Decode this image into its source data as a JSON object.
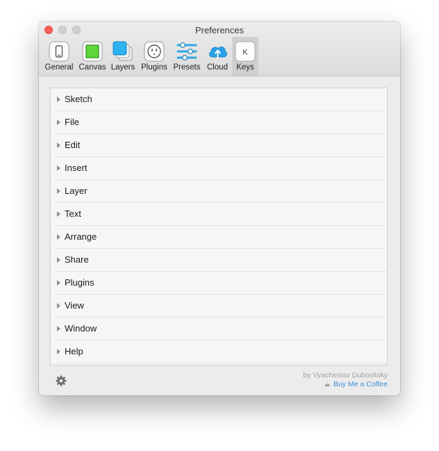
{
  "window": {
    "title": "Preferences"
  },
  "toolbar": {
    "items": [
      {
        "label": "General",
        "icon": "phone-icon"
      },
      {
        "label": "Canvas",
        "icon": "canvas-icon"
      },
      {
        "label": "Layers",
        "icon": "layers-icon"
      },
      {
        "label": "Plugins",
        "icon": "plug-icon"
      },
      {
        "label": "Presets",
        "icon": "sliders-icon"
      },
      {
        "label": "Cloud",
        "icon": "cloud-upload-icon"
      },
      {
        "label": "Keys",
        "icon": "key-icon",
        "icon_text": "K",
        "active": true
      }
    ]
  },
  "menu_list": {
    "items": [
      {
        "label": "Sketch"
      },
      {
        "label": "File"
      },
      {
        "label": "Edit"
      },
      {
        "label": "Insert"
      },
      {
        "label": "Layer"
      },
      {
        "label": "Text"
      },
      {
        "label": "Arrange"
      },
      {
        "label": "Share"
      },
      {
        "label": "Plugins"
      },
      {
        "label": "View"
      },
      {
        "label": "Window"
      },
      {
        "label": "Help"
      }
    ]
  },
  "footer": {
    "author": "by Vyacheslav Dubovitsky",
    "coffee_icon": "☕",
    "coffee_link": "Buy Me a Coffee"
  },
  "colors": {
    "close": "#fc5f57",
    "link": "#3d8fd6",
    "canvas_green": "#5fd63a",
    "cloud_blue": "#29a3e8"
  }
}
